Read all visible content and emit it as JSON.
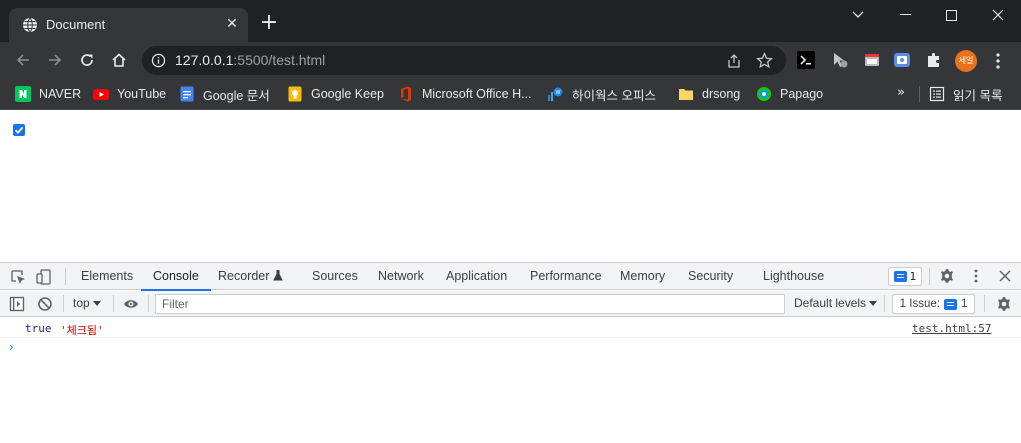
{
  "tab": {
    "title": "Document",
    "close": "✕",
    "new_tab": "+"
  },
  "omnibox": {
    "host": "127.0.0.1",
    "path": ":5500/test.html"
  },
  "profile": {
    "avatar_text": "세일"
  },
  "bookmarks": [
    {
      "label": "NAVER",
      "icon": "naver-icon"
    },
    {
      "label": "YouTube",
      "icon": "youtube-icon"
    },
    {
      "label": "Google 문서",
      "icon": "google-docs-icon"
    },
    {
      "label": "Google Keep",
      "icon": "google-keep-icon"
    },
    {
      "label": "Microsoft Office H...",
      "icon": "office-icon"
    },
    {
      "label": "하이웍스 오피스",
      "icon": "hiworks-icon"
    },
    {
      "label": "drsong",
      "icon": "folder-icon"
    },
    {
      "label": "Papago",
      "icon": "papago-icon"
    }
  ],
  "bookmarks_more": "»",
  "reading_list": "읽기 목록",
  "page": {
    "checkbox_checked": true
  },
  "devtools": {
    "tabs": [
      "Elements",
      "Console",
      "Recorder",
      "Sources",
      "Network",
      "Application",
      "Performance",
      "Memory",
      "Security",
      "Lighthouse"
    ],
    "active_tab": "Console",
    "issues_count": "1",
    "context": "top",
    "filter_placeholder": "Filter",
    "levels": "Default levels",
    "issue_button": "1 Issue:",
    "issue_button_count": "1"
  },
  "console": {
    "logs": [
      {
        "value": "true",
        "string": "'체크됨'",
        "source": "test.html:57"
      }
    ],
    "prompt": "›"
  },
  "colors": {
    "accent": "#1a73e8",
    "chrome_dark": "#202124",
    "chrome_toolbar": "#35363a",
    "avatar": "#e8711c"
  }
}
